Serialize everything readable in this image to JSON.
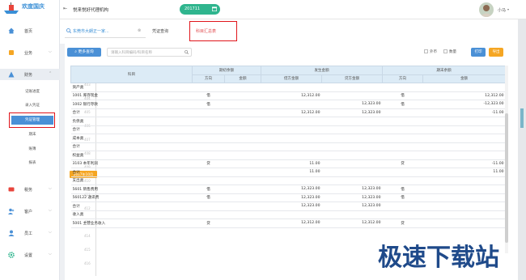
{
  "app": {
    "logo_text": "欢度国庆",
    "title": "悦来悦好代理机构",
    "period": "201711",
    "user": "小马"
  },
  "sidebar": {
    "items": [
      {
        "label": "首页",
        "icon": "home-icon"
      },
      {
        "label": "业务",
        "icon": "business-icon"
      },
      {
        "label": "财务",
        "icon": "finance-icon"
      },
      {
        "label": "税务",
        "icon": "tax-icon"
      },
      {
        "label": "客户",
        "icon": "customer-icon"
      },
      {
        "label": "员工",
        "icon": "staff-icon"
      },
      {
        "label": "设置",
        "icon": "settings-icon"
      }
    ],
    "sub_items": [
      "记账进度",
      "录入凭证",
      "凭证管理",
      "期末",
      "账簿",
      "报表"
    ],
    "active_sub": "凭证管理"
  },
  "tabs": {
    "company": "东莞市大朗正一家...",
    "voucher_query": "凭证查询",
    "subject_summary": "科目汇总表"
  },
  "toolbar": {
    "more_query": "更多查询",
    "search_placeholder": "请输入科目编码/科目名称",
    "foreign_currency": "外币",
    "quantity": "数量",
    "print": "打印",
    "export": "导出"
  },
  "table": {
    "header": {
      "subject": "科目",
      "opening": "期初余额",
      "occurrence": "发生金额",
      "closing": "期末余额",
      "direction": "方向",
      "amount": "金额",
      "debit": "借方金额",
      "credit": "贷方金额"
    },
    "rows": [
      {
        "subject": "资产类",
        "od": "",
        "oa": "",
        "debit": "",
        "credit": "",
        "cd": "",
        "ca": ""
      },
      {
        "subject": "1001 库存现金",
        "od": "借",
        "oa": "",
        "debit": "12,312.00",
        "credit": "",
        "cd": "借",
        "ca": "12,312.00"
      },
      {
        "subject": "1002 银行存款",
        "od": "借",
        "oa": "",
        "debit": "",
        "credit": "12,323.00",
        "cd": "借",
        "ca": "-12,323.00"
      },
      {
        "subject": "合计",
        "od": "",
        "oa": "",
        "debit": "12,312.00",
        "credit": "12,323.00",
        "cd": "",
        "ca": "-11.00"
      },
      {
        "subject": "负债类",
        "od": "",
        "oa": "",
        "debit": "",
        "credit": "",
        "cd": "",
        "ca": ""
      },
      {
        "subject": "合计",
        "od": "",
        "oa": "",
        "debit": "",
        "credit": "",
        "cd": "",
        "ca": ""
      },
      {
        "subject": "成本类",
        "od": "",
        "oa": "",
        "debit": "",
        "credit": "",
        "cd": "",
        "ca": ""
      },
      {
        "subject": "合计",
        "od": "",
        "oa": "",
        "debit": "",
        "credit": "",
        "cd": "",
        "ca": ""
      },
      {
        "subject": "权益类",
        "od": "",
        "oa": "",
        "debit": "",
        "credit": "",
        "cd": "",
        "ca": ""
      },
      {
        "subject": "3103 本年利润",
        "od": "贷",
        "oa": "",
        "debit": "11.00",
        "credit": "",
        "cd": "贷",
        "ca": "-11.00"
      },
      {
        "subject": "合计",
        "od": "",
        "oa": "",
        "debit": "11.00",
        "credit": "",
        "cd": "",
        "ca": "11.00"
      },
      {
        "subject": "支出类",
        "od": "",
        "oa": "",
        "debit": "",
        "credit": "",
        "cd": "",
        "ca": ""
      },
      {
        "subject": "5601 销售费用",
        "od": "借",
        "oa": "",
        "debit": "12,323.00",
        "credit": "12,323.00",
        "cd": "借",
        "ca": ""
      },
      {
        "subject": "560122 通讯费",
        "od": "借",
        "oa": "",
        "debit": "12,323.00",
        "credit": "12,323.00",
        "cd": "借",
        "ca": ""
      },
      {
        "subject": "合计",
        "od": "",
        "oa": "",
        "debit": "12,323.00",
        "credit": "12,323.00",
        "cd": "",
        "ca": ""
      },
      {
        "subject": "收入类",
        "od": "",
        "oa": "",
        "debit": "",
        "credit": "",
        "cd": "",
        "ca": ""
      },
      {
        "subject": "5001 主营业务收入",
        "od": "贷",
        "oa": "",
        "debit": "12,312.00",
        "credit": "12,312.00",
        "cd": "贷",
        "ca": ""
      }
    ]
  },
  "rail": {
    "date_badge": "2017年10月",
    "line_numbers": [
      "402",
      "403",
      "404",
      "405",
      "406",
      "407",
      "408",
      "409",
      "410",
      "411",
      "412",
      "413",
      "414",
      "415",
      "416"
    ]
  },
  "watermark": {
    "text": "极速下载站"
  },
  "colors": {
    "brand_blue": "#4a90d6",
    "accent_green": "#2fb58e",
    "export_orange": "#f5a623",
    "highlight_red": "#e0151b"
  }
}
